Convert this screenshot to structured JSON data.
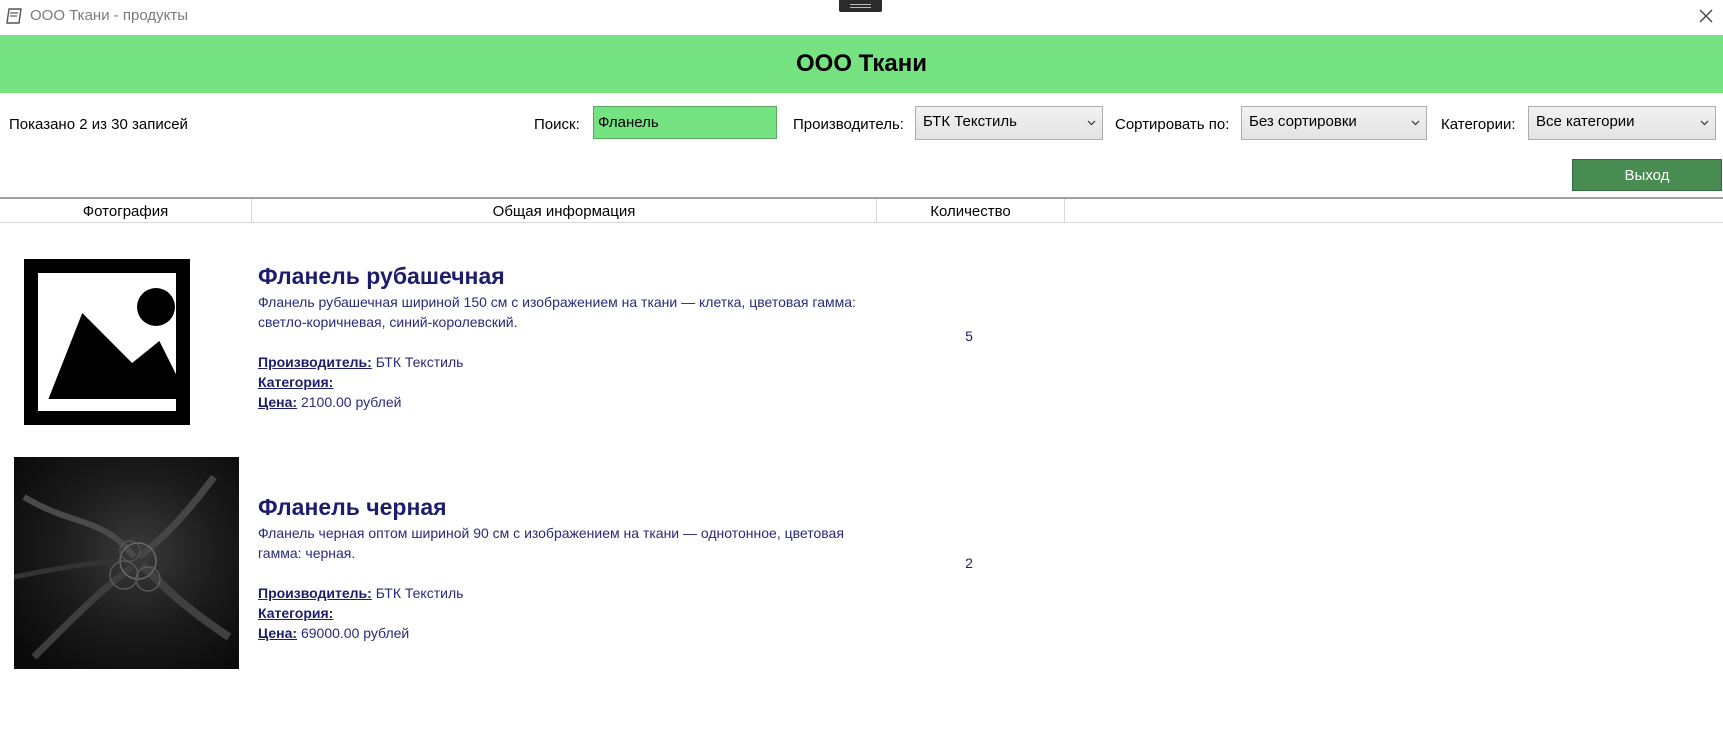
{
  "window": {
    "title": "ООО Ткани - продукты"
  },
  "header": {
    "title": "ООО Ткани"
  },
  "toolbar": {
    "records_label": "Показано 2 из 30 записей",
    "search_label": "Поиск:",
    "search_value": "Фланель",
    "manufacturer_label": "Производитель:",
    "manufacturer_value": "БТК Текстиль",
    "sort_label": "Сортировать по:",
    "sort_value": "Без сортировки",
    "category_label": "Категории:",
    "category_value": "Все категории",
    "exit_label": "Выход"
  },
  "grid": {
    "columns": [
      "Фотография",
      "Общая информация",
      "Количество"
    ],
    "rows": [
      {
        "name": "Фланель рубашечная",
        "description": "Фланель рубашечная шириной 150 см с изображением на ткани — клетка, цветовая гамма: светло-коричневая, синий-королевский.",
        "manufacturer_label": "Производитель:",
        "manufacturer": "БТК Текстиль",
        "category_label": "Категория:",
        "category": "",
        "price_label": "Цена:",
        "price": "2100.00 рублей",
        "quantity": "5",
        "photo": "placeholder-icon"
      },
      {
        "name": "Фланель черная",
        "description": "Фланель черная оптом шириной 90 см с изображением на ткани — однотонное, цветовая гамма: черная.",
        "manufacturer_label": "Производитель:",
        "manufacturer": "БТК Текстиль",
        "category_label": "Категория:",
        "category": "",
        "price_label": "Цена:",
        "price": "69000.00 рублей",
        "quantity": "2",
        "photo": "black-fabric-photo"
      }
    ]
  },
  "colors": {
    "header_bg": "#76e383",
    "accent_button": "#498c51",
    "text_primary": "#1d1d6b"
  }
}
